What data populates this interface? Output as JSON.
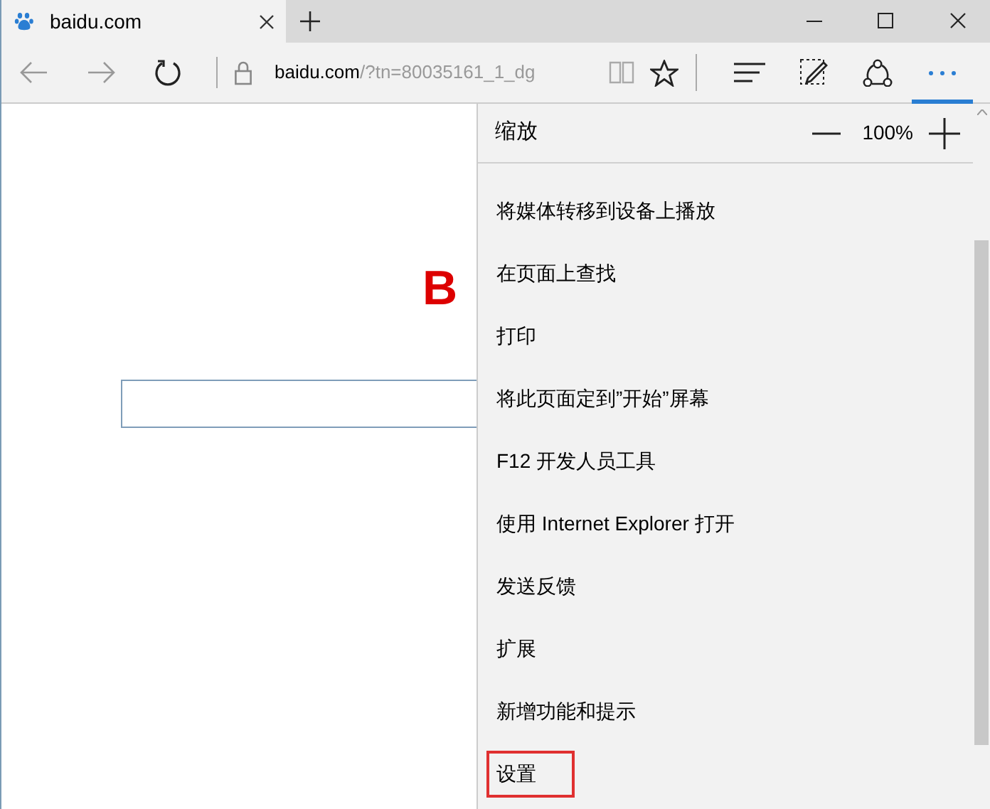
{
  "tab": {
    "title": "baidu.com"
  },
  "address": {
    "domain": "baidu.com",
    "path": "/?tn=80035161_1_dg"
  },
  "more_button": {
    "selected": true
  },
  "page": {
    "logo_text": "B"
  },
  "menu": {
    "zoom": {
      "label": "缩放",
      "value": "100%"
    },
    "items": [
      {
        "label": "将媒体转移到设备上播放",
        "highlighted": false
      },
      {
        "label": "在页面上查找",
        "highlighted": false
      },
      {
        "label": "打印",
        "highlighted": false
      },
      {
        "label": "将此页面定到”开始”屏幕",
        "highlighted": false
      },
      {
        "label": "F12 开发人员工具",
        "highlighted": false
      },
      {
        "label": "使用 Internet Explorer 打开",
        "highlighted": false
      },
      {
        "label": "发送反馈",
        "highlighted": false
      },
      {
        "label": "扩展",
        "highlighted": false
      },
      {
        "label": "新增功能和提示",
        "highlighted": false
      },
      {
        "label": "设置",
        "highlighted": true
      }
    ]
  }
}
